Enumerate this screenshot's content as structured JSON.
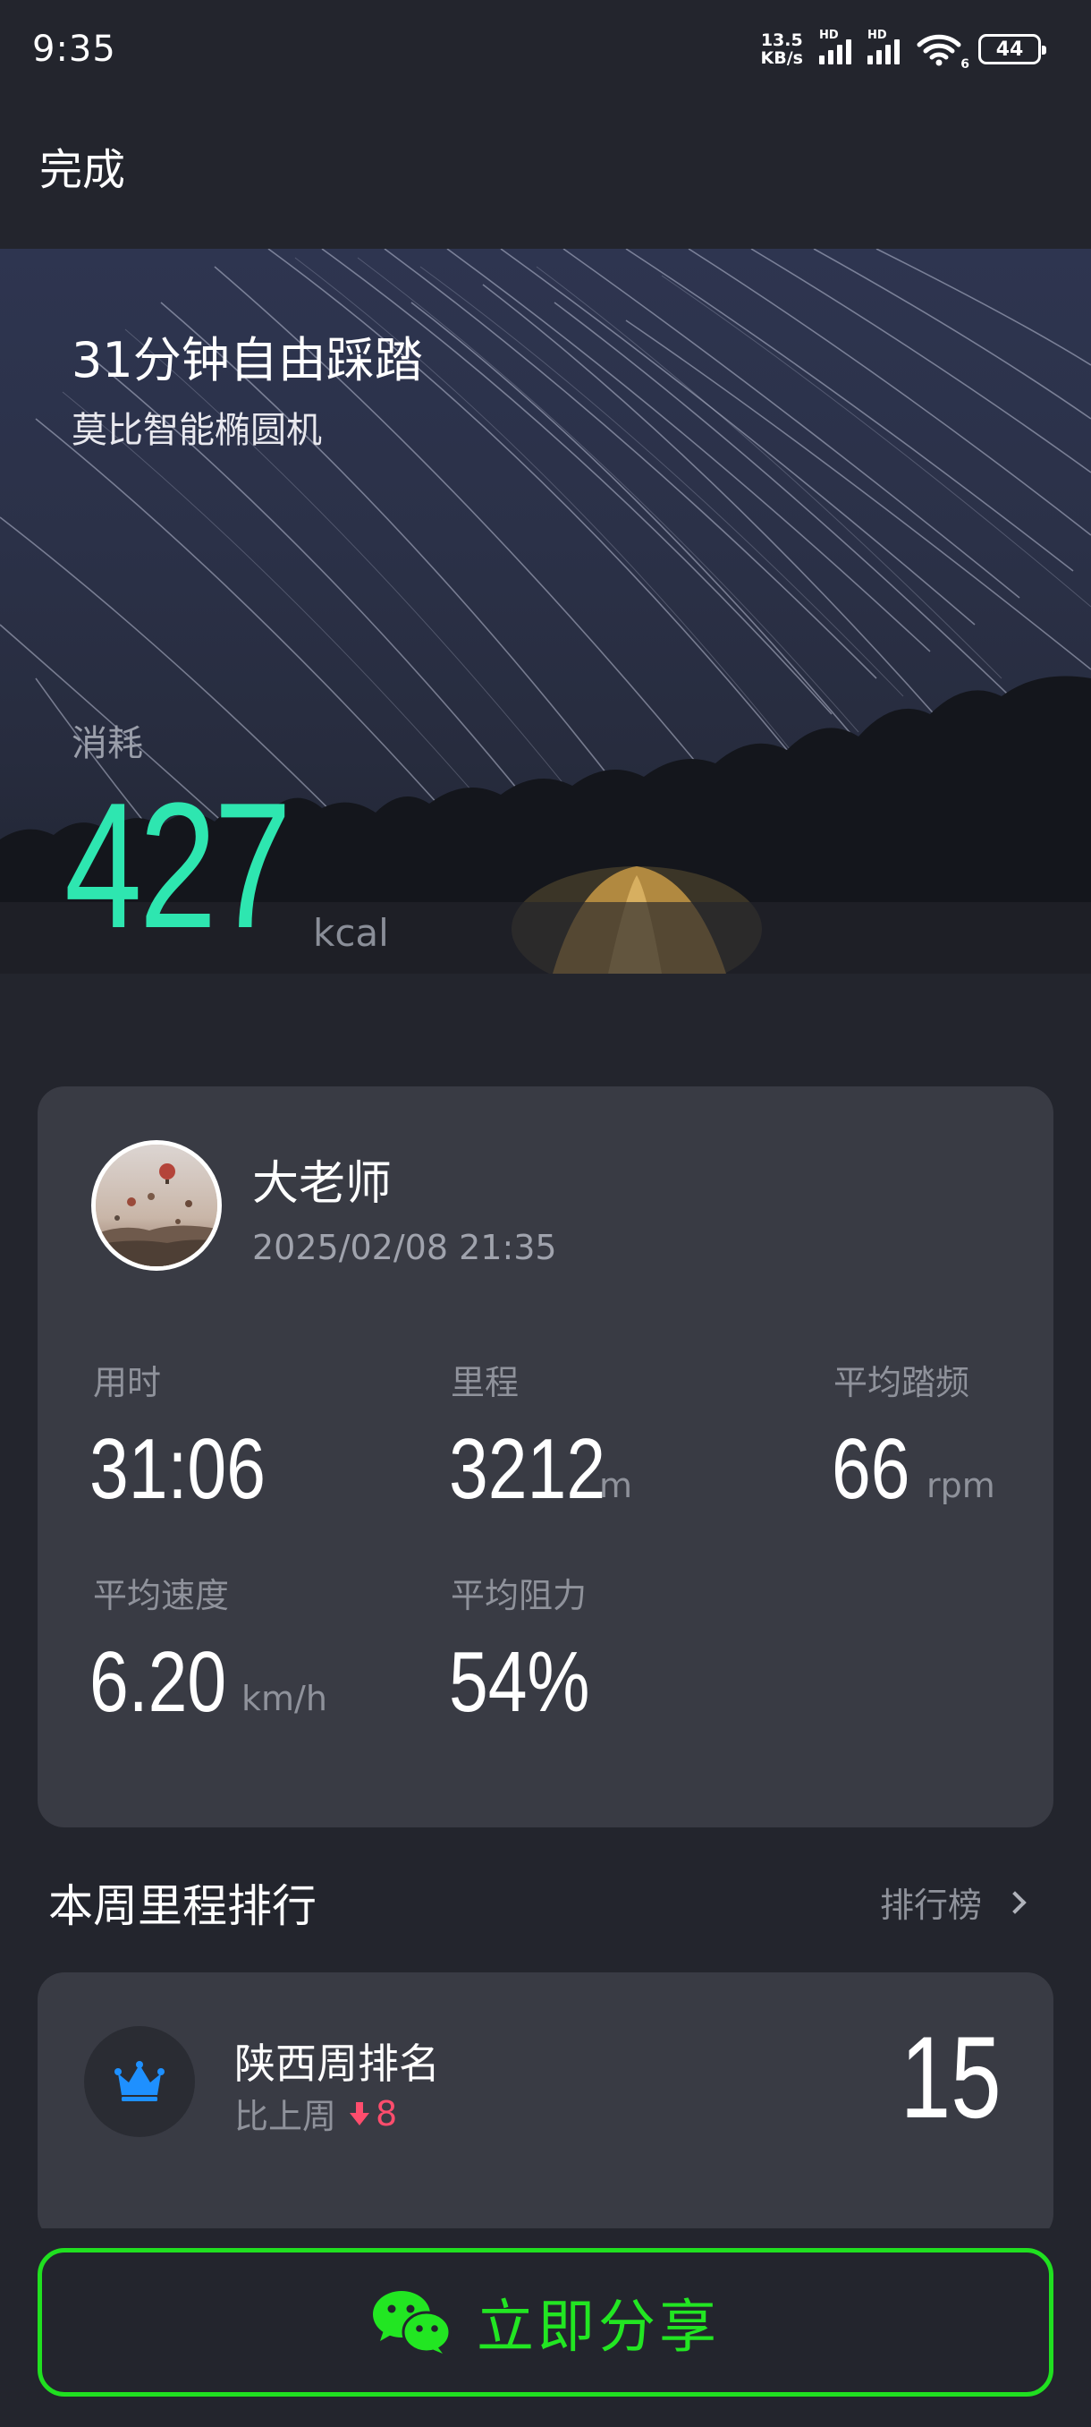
{
  "status_bar": {
    "time": "9:35",
    "net_speed_value": "13.5",
    "net_speed_unit": "KB/s",
    "signal_label": "HD",
    "wifi_label": "6",
    "battery": "44"
  },
  "header": {
    "done_label": "完成"
  },
  "hero": {
    "title": "31分钟自由踩踏",
    "device": "莫比智能椭圆机",
    "calorie_label": "消耗",
    "calorie_value": "427",
    "calorie_unit": "kcal"
  },
  "summary": {
    "user_name": "大老师",
    "datetime": "2025/02/08 21:35",
    "metrics": [
      {
        "label": "用时",
        "value": "31:06",
        "unit": ""
      },
      {
        "label": "里程",
        "value": "3212",
        "unit": "m"
      },
      {
        "label": "平均踏频",
        "value": "66",
        "unit": "rpm"
      },
      {
        "label": "平均速度",
        "value": "6.20",
        "unit": "km/h"
      },
      {
        "label": "平均阻力",
        "value": "54%",
        "unit": ""
      }
    ]
  },
  "weekly": {
    "title": "本周里程排行",
    "leaderboard_link": "排行榜",
    "rank_title": "陕西周排名",
    "compare_label": "比上周",
    "change_value": "8",
    "rank_value": "15"
  },
  "share": {
    "label": "立即分享"
  },
  "colors": {
    "accent_green": "#2ee6b0",
    "share_green": "#22e622",
    "down_red": "#ff4d6d",
    "crown_blue": "#1e90ff"
  }
}
